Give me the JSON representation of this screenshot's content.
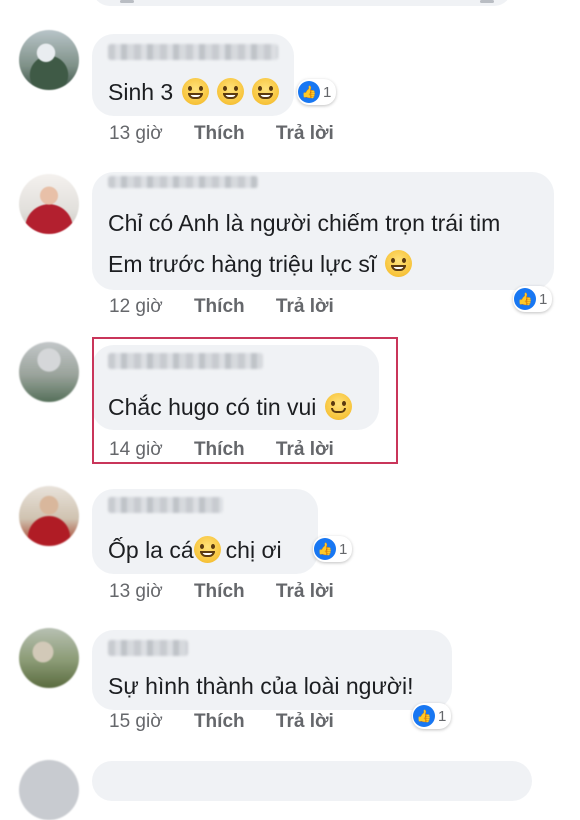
{
  "comments": [
    {
      "text": "Sinh 3",
      "emoji": [
        "grinning-sweat-emoji",
        "grinning-sweat-emoji",
        "grinning-sweat-emoji"
      ],
      "reactions": "1",
      "time": "13 giờ",
      "like": "Thích",
      "reply": "Trả lời"
    },
    {
      "line1": "Chỉ có Anh là người chiếm trọn trái tim",
      "line2": "Em trước hàng triệu lực sĩ",
      "emoji": [
        "grinning-emoji"
      ],
      "reactions": "1",
      "time": "12 giờ",
      "like": "Thích",
      "reply": "Trả lời"
    },
    {
      "text": "Chắc hugo có tin vui",
      "emoji": [
        "smiling-emoji"
      ],
      "time": "14 giờ",
      "like": "Thích",
      "reply": "Trả lời",
      "highlight_color": "#c9355a"
    },
    {
      "text_before": "Ốp la cá",
      "text_after": "chị ơi",
      "emoji": [
        "grinning-emoji"
      ],
      "reactions": "1",
      "time": "13 giờ",
      "like": "Thích",
      "reply": "Trả lời"
    },
    {
      "text": "Sự hình thành của loài người!",
      "reactions": "1",
      "time": "15 giờ",
      "like": "Thích",
      "reply": "Trả lời"
    }
  ],
  "colors": {
    "bubble": "#f0f2f5",
    "like_blue": "#1877f2",
    "meta_gray": "#65676b"
  }
}
